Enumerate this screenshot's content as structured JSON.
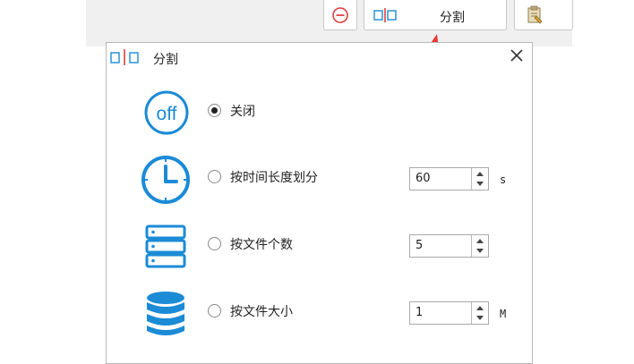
{
  "toolbar": {
    "minus_icon": "minus-circle-icon",
    "split_icon": "split-icon",
    "split_label": "分割",
    "clipboard_icon": "clipboard-icon"
  },
  "dialog": {
    "title": "分割",
    "options": [
      {
        "icon": "off-icon",
        "label": "关闭",
        "checked": true
      },
      {
        "icon": "clock-icon",
        "label": "按时间长度划分",
        "checked": false,
        "value": "60",
        "unit": "s"
      },
      {
        "icon": "server-icon",
        "label": "按文件个数",
        "checked": false,
        "value": "5"
      },
      {
        "icon": "database-icon",
        "label": "按文件大小",
        "checked": false,
        "value": "1",
        "unit": "M"
      }
    ]
  },
  "colors": {
    "accent": "#1b8bd6",
    "arrow": "#e8372f",
    "red_icon": "#e04040"
  }
}
